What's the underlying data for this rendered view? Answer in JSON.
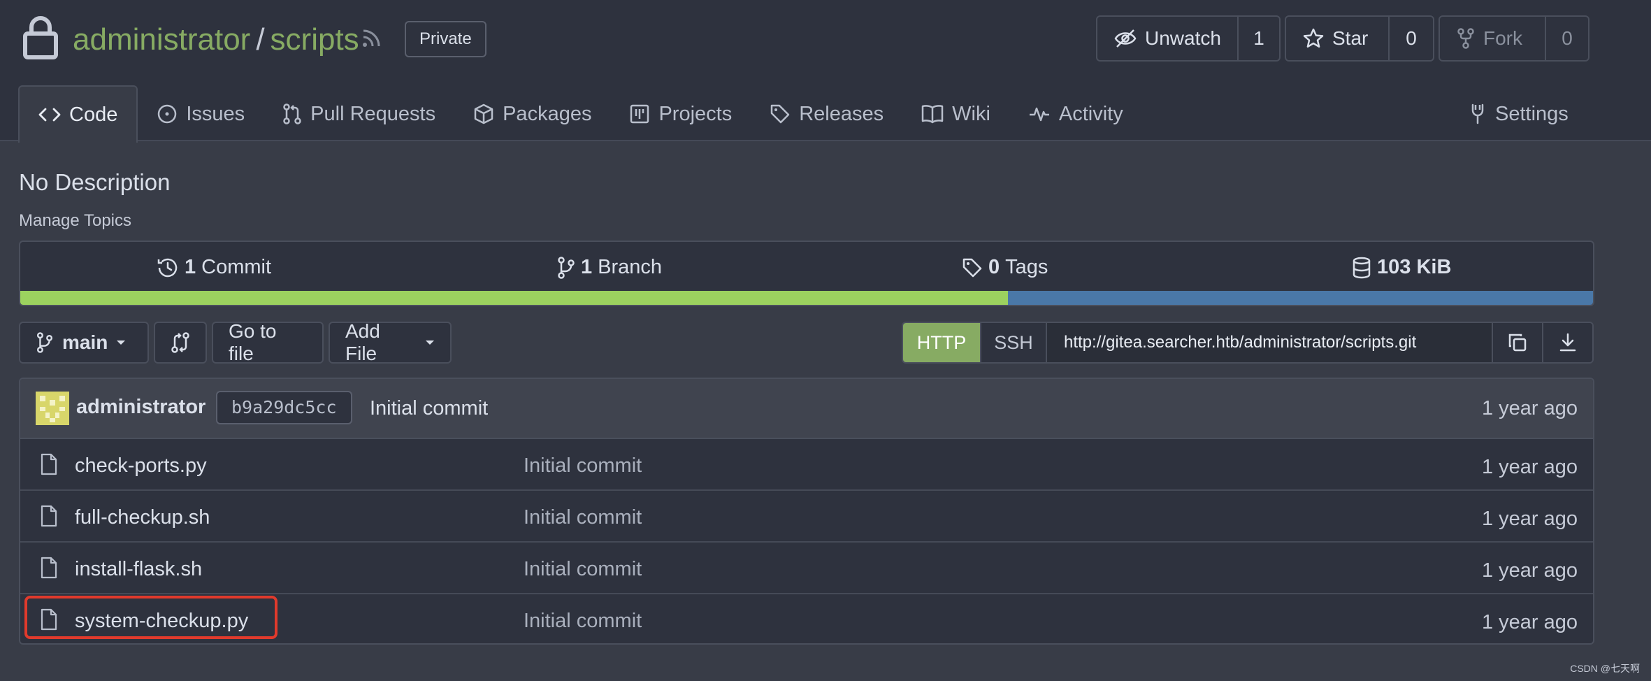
{
  "repo": {
    "owner": "administrator",
    "separator": "/",
    "name": "scripts",
    "visibility": "Private"
  },
  "actions": {
    "watch": {
      "label": "Unwatch",
      "count": "1"
    },
    "star": {
      "label": "Star",
      "count": "0"
    },
    "fork": {
      "label": "Fork",
      "count": "0"
    }
  },
  "tabs": [
    "Code",
    "Issues",
    "Pull Requests",
    "Packages",
    "Projects",
    "Releases",
    "Wiki",
    "Activity"
  ],
  "settings_label": "Settings",
  "description": "No Description",
  "manage_topics": "Manage Topics",
  "stats": {
    "commits": {
      "num": "1",
      "label": "Commit"
    },
    "branches": {
      "num": "1",
      "label": "Branch"
    },
    "tags": {
      "num": "0",
      "label": "Tags"
    },
    "size": "103 KiB"
  },
  "language_bar": {
    "segments": [
      {
        "percent": 62.8,
        "color": "#9cd25f"
      },
      {
        "percent": 37.2,
        "color": "#4a78a8"
      }
    ]
  },
  "toolbar": {
    "branch": "main",
    "go_to_file": "Go to file",
    "add_file": "Add File"
  },
  "clone": {
    "http": "HTTP",
    "ssh": "SSH",
    "url": "http://gitea.searcher.htb/administrator/scripts.git"
  },
  "latest_commit": {
    "author": "administrator",
    "sha": "b9a29dc5cc",
    "message": "Initial commit",
    "age": "1 year ago"
  },
  "files": [
    {
      "name": "check-ports.py",
      "message": "Initial commit",
      "age": "1 year ago"
    },
    {
      "name": "full-checkup.sh",
      "message": "Initial commit",
      "age": "1 year ago"
    },
    {
      "name": "install-flask.sh",
      "message": "Initial commit",
      "age": "1 year ago"
    },
    {
      "name": "system-checkup.py",
      "message": "Initial commit",
      "age": "1 year ago"
    }
  ],
  "watermark": "CSDN @七天啊",
  "colors": {
    "accent": "#87ab63",
    "highlight": "#e13a2c"
  }
}
